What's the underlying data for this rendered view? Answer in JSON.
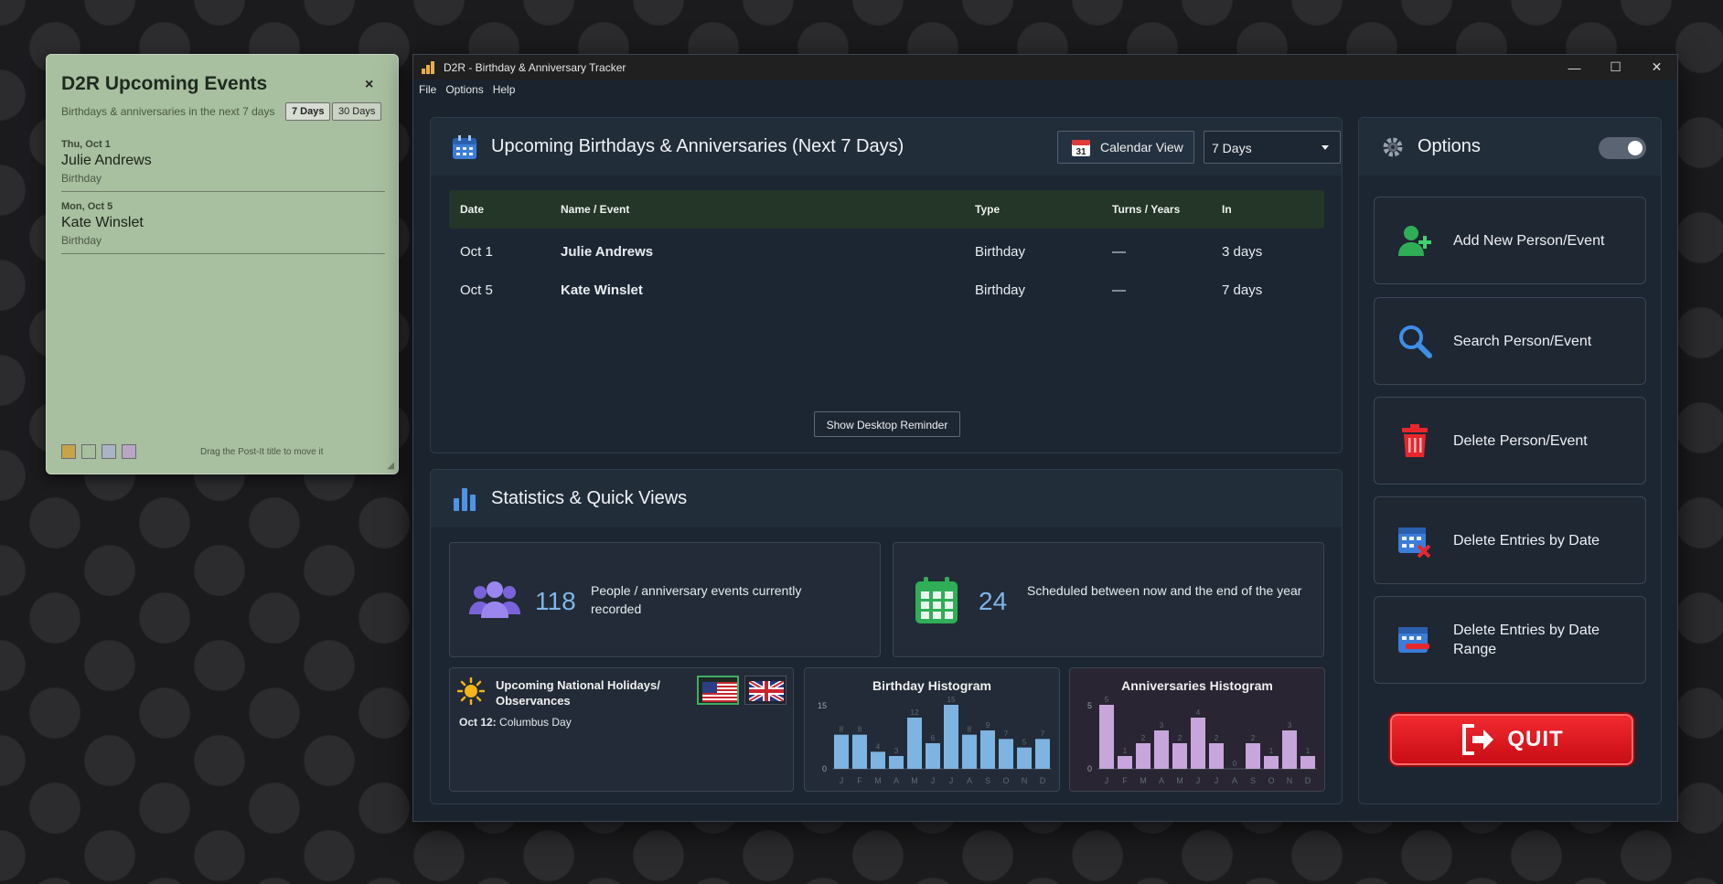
{
  "postit": {
    "title": "D2R Upcoming Events",
    "close": "×",
    "subtitle": "Birthdays & anniversaries in the next 7 days",
    "btn7": "7 Days",
    "btn30": "30 Days",
    "events": [
      {
        "date": "Thu, Oct 1",
        "name": "Julie Andrews",
        "type": "Birthday"
      },
      {
        "date": "Mon, Oct 5",
        "name": "Kate Winslet",
        "type": "Birthday"
      }
    ],
    "swatch_colors": [
      "#c9a24a",
      "#a8bfa0",
      "#a9b5c6",
      "#b8a6c4"
    ],
    "drag_hint": "Drag the Post-It title to move it"
  },
  "window": {
    "title": "D2R - Birthday & Anniversary Tracker",
    "menu": [
      "File",
      "Options",
      "Help"
    ]
  },
  "upcoming": {
    "title": "Upcoming Birthdays & Anniversaries (Next 7 Days)",
    "calendar_btn": "Calendar View",
    "calendar_icon_day": "31",
    "range_selected": "7 Days",
    "columns": [
      "Date",
      "Name / Event",
      "Type",
      "Turns / Years",
      "In"
    ],
    "rows": [
      {
        "date": "Oct 1",
        "name": "Julie Andrews",
        "type": "Birthday",
        "turns": "—",
        "in": "3 days"
      },
      {
        "date": "Oct 5",
        "name": "Kate Winslet",
        "type": "Birthday",
        "turns": "—",
        "in": "7 days"
      }
    ],
    "reminder_btn": "Show Desktop Reminder"
  },
  "stats": {
    "title": "Statistics & Quick Views",
    "people_count": "118",
    "people_desc": "People / anniversary events currently recorded",
    "scheduled_count": "24",
    "scheduled_desc": "Scheduled between now and the end of the year",
    "holidays_title": "Upcoming National Holidays/ Observances",
    "holiday_date": "Oct 12:",
    "holiday_name": "Columbus Day",
    "birthday_hist_title": "Birthday Histogram",
    "anniv_hist_title": "Anniversaries Histogram"
  },
  "chart_data": [
    {
      "type": "bar",
      "title": "Birthday Histogram",
      "categories": [
        "J",
        "F",
        "M",
        "A",
        "M",
        "J",
        "J",
        "A",
        "S",
        "O",
        "N",
        "D"
      ],
      "values": [
        8,
        8,
        4,
        3,
        12,
        6,
        15,
        8,
        9,
        7,
        5,
        7
      ],
      "ylim": [
        0,
        15
      ],
      "yticks": [
        "15",
        "0"
      ],
      "color": "#7eb4e2"
    },
    {
      "type": "bar",
      "title": "Anniversaries Histogram",
      "categories": [
        "J",
        "F",
        "M",
        "A",
        "M",
        "J",
        "J",
        "A",
        "S",
        "O",
        "N",
        "D"
      ],
      "values": [
        5,
        1,
        2,
        3,
        2,
        4,
        2,
        0,
        2,
        1,
        3,
        1
      ],
      "ylim": [
        0,
        5
      ],
      "yticks": [
        "5",
        "0"
      ],
      "color": "#c7a6dc"
    }
  ],
  "options": {
    "title": "Options",
    "buttons": [
      {
        "label": "Add New Person/Event"
      },
      {
        "label": "Search Person/Event"
      },
      {
        "label": "Delete Person/Event"
      },
      {
        "label": "Delete Entries by Date"
      },
      {
        "label": "Delete Entries by Date Range"
      }
    ],
    "quit": "QUIT"
  }
}
